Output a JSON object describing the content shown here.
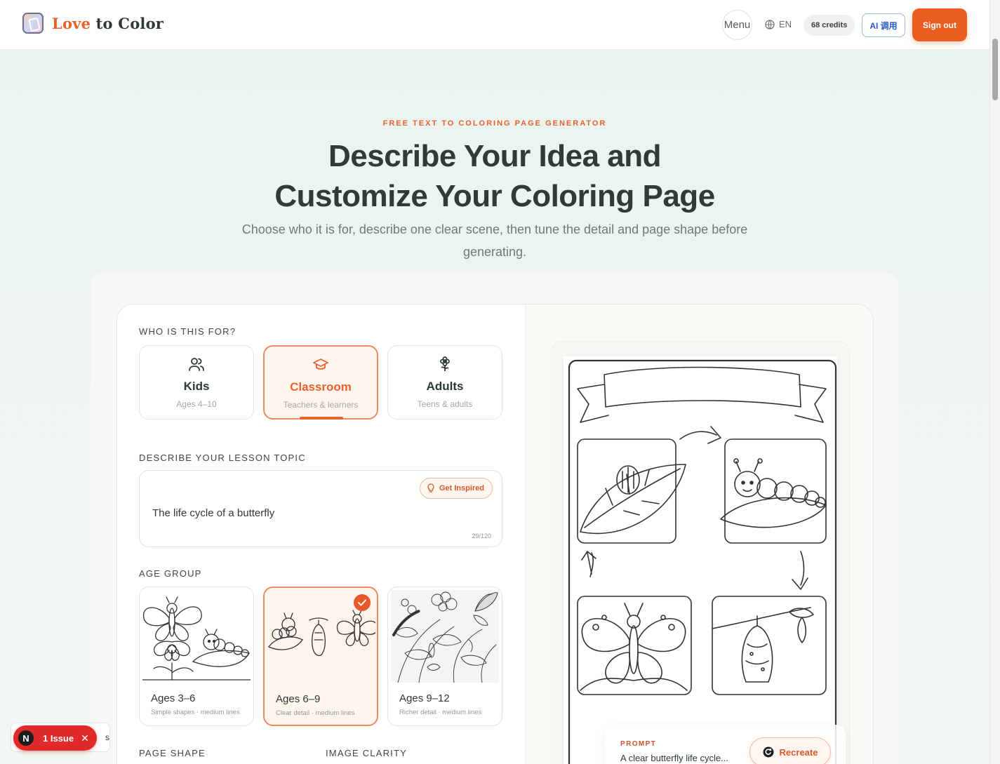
{
  "header": {
    "brand_part1": "Love",
    "brand_part2": "to Color",
    "menu_label": "Menu",
    "language": "EN",
    "credits": "68 credits",
    "ai_label": "AI 调用",
    "signout_label": "Sign out"
  },
  "hero": {
    "eyebrow": "FREE TEXT TO COLORING PAGE GENERATOR",
    "title_line1": "Describe Your Idea and",
    "title_line2": "Customize Your Coloring Page",
    "subtitle": "Choose who it is for, describe one clear scene, then tune the detail and page shape before generating."
  },
  "form": {
    "audience_label": "WHO IS THIS FOR?",
    "audiences": [
      {
        "title": "Kids",
        "subtitle": "Ages 4–10",
        "icon": "users-icon"
      },
      {
        "title": "Classroom",
        "subtitle": "Teachers & learners",
        "icon": "graduation-cap-icon",
        "selected": true
      },
      {
        "title": "Adults",
        "subtitle": "Teens & adults",
        "icon": "flower-icon"
      }
    ],
    "topic_label": "DESCRIBE YOUR LESSON TOPIC",
    "topic_value": "The life cycle of a butterfly",
    "get_inspired": "Get Inspired",
    "counter": "29/120",
    "age_label": "AGE GROUP",
    "ages": [
      {
        "title": "Ages 3–6",
        "subtitle": "Simple shapes · medium lines"
      },
      {
        "title": "Ages 6–9",
        "subtitle": "Clear detail · medium lines",
        "selected": true
      },
      {
        "title": "Ages 9–12",
        "subtitle": "Richer detail · medium lines"
      }
    ],
    "page_shape_label": "PAGE SHAPE",
    "image_clarity_label": "IMAGE CLARITY"
  },
  "preview": {
    "prompt_label": "PROMPT",
    "prompt_text": "A clear butterfly life cycle...",
    "recreate_label": "Recreate",
    "carousel_count": 4,
    "carousel_active": 1
  },
  "issue_badge": {
    "letter": "N",
    "label": "1 Issue",
    "trailing": "s"
  },
  "colors": {
    "accent": "#e8622c",
    "text_dark": "#2f3b36",
    "background": "#eaf3f0",
    "issue_red": "#e02a2a"
  }
}
